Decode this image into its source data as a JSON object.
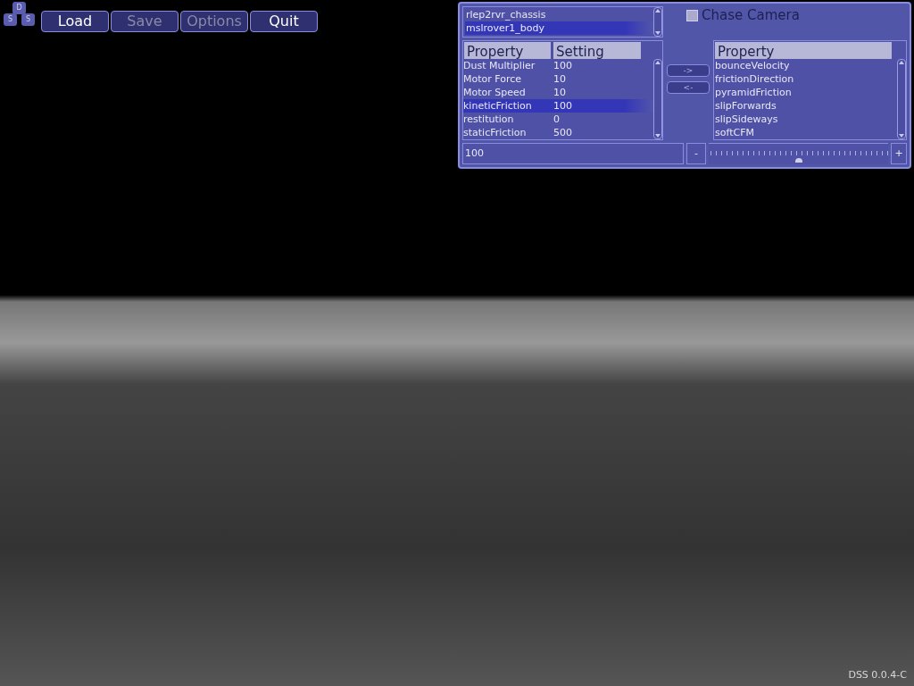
{
  "logo": {
    "letters": [
      "D",
      "S",
      "S"
    ]
  },
  "menu": [
    {
      "label": "Load",
      "disabled": false
    },
    {
      "label": "Save",
      "disabled": true
    },
    {
      "label": "Options",
      "disabled": true
    },
    {
      "label": "Quit",
      "disabled": false
    }
  ],
  "object_list": {
    "items": [
      {
        "label": "rlep2rvr_chassis",
        "selected": false
      },
      {
        "label": "mslrover1_body",
        "selected": true
      }
    ]
  },
  "chase_camera": {
    "label": "Chase Camera",
    "checked": false
  },
  "property_table": {
    "columns": [
      "Property",
      "Setting"
    ],
    "rows": [
      {
        "property": "Dust Multiplier",
        "setting": "100",
        "selected": false
      },
      {
        "property": "Motor Force",
        "setting": "10",
        "selected": false
      },
      {
        "property": "Motor Speed",
        "setting": "10",
        "selected": false
      },
      {
        "property": "kineticFriction",
        "setting": "100",
        "selected": true
      },
      {
        "property": "restitution",
        "setting": "0",
        "selected": false
      },
      {
        "property": "staticFriction",
        "setting": "500",
        "selected": false
      }
    ]
  },
  "transfer_buttons": [
    "->",
    "<-"
  ],
  "available_properties": {
    "column": "Property",
    "items": [
      "bounceVelocity",
      "frictionDirection",
      "pyramidFriction",
      "slipForwards",
      "slipSideways",
      "softCFM"
    ]
  },
  "value_field": {
    "value": "100"
  },
  "slider": {
    "minus": "-",
    "plus": "+",
    "level": 0.5
  },
  "version": "DSS 0.0.4-C"
}
